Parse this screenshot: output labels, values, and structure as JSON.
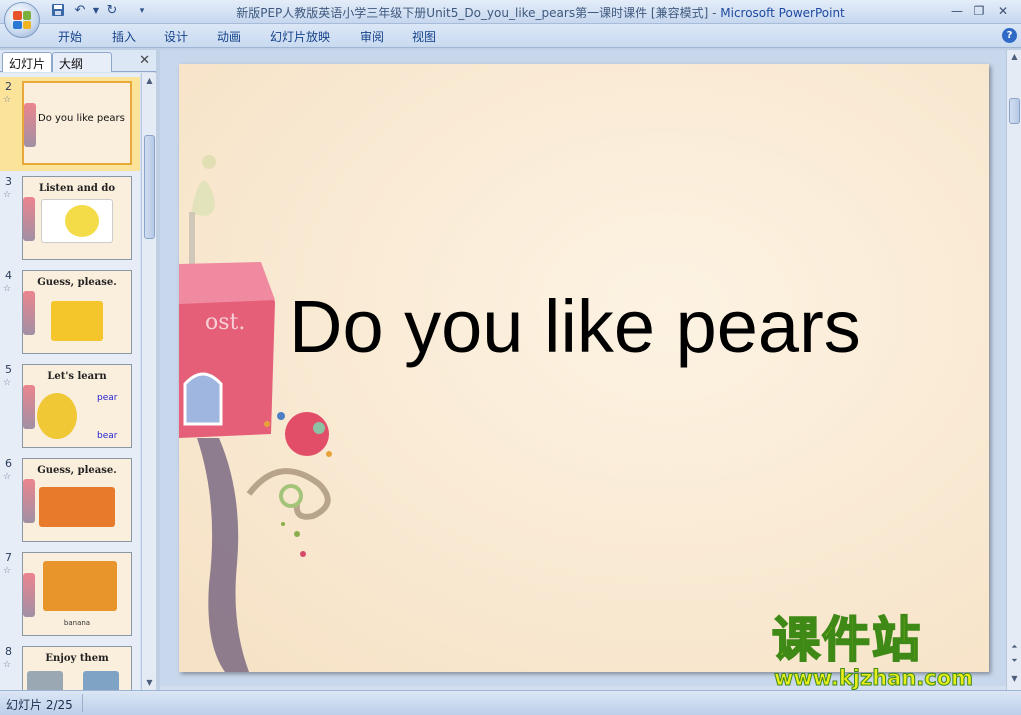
{
  "window": {
    "title_doc": "新版PEP人教版英语小学三年级下册Unit5_Do_you_like_pears第一课时课件 [兼容模式]",
    "title_sep": " - ",
    "title_app": "Microsoft PowerPoint"
  },
  "quick_access": {
    "icons": [
      "save-icon",
      "undo-icon",
      "redo-icon",
      "customize-icon"
    ]
  },
  "ribbon": {
    "tabs": [
      "开始",
      "插入",
      "设计",
      "动画",
      "幻灯片放映",
      "审阅",
      "视图"
    ]
  },
  "pane": {
    "tabs": [
      "幻灯片",
      "大纲"
    ],
    "close": "✕"
  },
  "thumbnails": [
    {
      "number": "2",
      "text": "Do you like pears",
      "selected": true
    },
    {
      "number": "3",
      "text": "Listen and do",
      "selected": false
    },
    {
      "number": "4",
      "text": "Guess, please.",
      "selected": false
    },
    {
      "number": "5",
      "text": "Let's learn",
      "words": [
        "pear",
        "bear"
      ],
      "selected": false
    },
    {
      "number": "6",
      "text": "Guess, please.",
      "selected": false
    },
    {
      "number": "7",
      "text": "banana",
      "selected": false
    },
    {
      "number": "8",
      "text": "Enjoy them",
      "selected": false
    }
  ],
  "slide": {
    "title": "Do you like pears"
  },
  "status": {
    "slide_indicator": "幻灯片 2/25"
  },
  "watermark": {
    "text": "课件站",
    "url": "www.kjzhan.com"
  },
  "colors": {
    "slide_bg": "#fbecd6",
    "selected_thumb": "#fce39a",
    "ribbon_tab_text": "#15428b",
    "watermark_fill": "#e8ee1a",
    "watermark_stroke": "#3f8a16"
  }
}
